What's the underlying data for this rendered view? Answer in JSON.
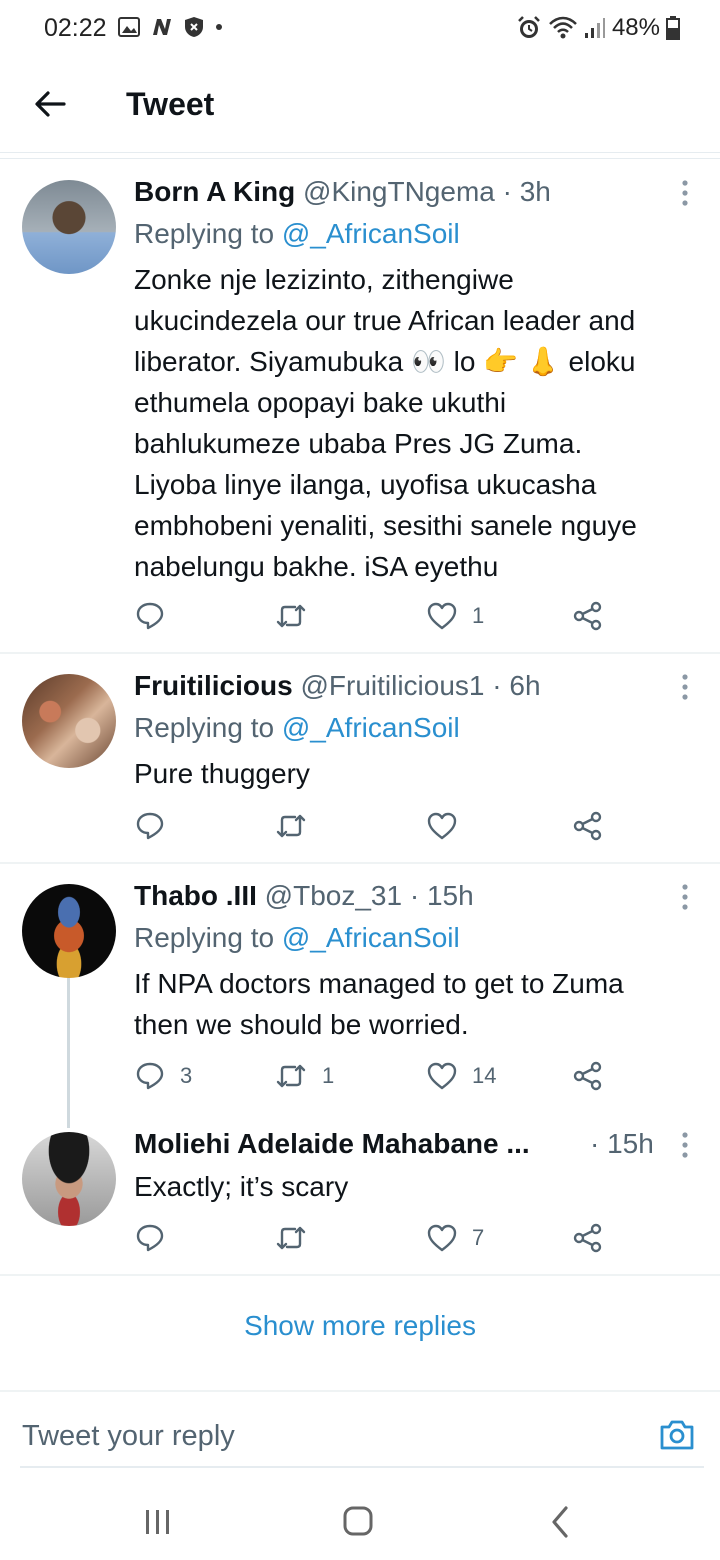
{
  "status_bar": {
    "time": "02:22",
    "battery": "48%"
  },
  "header": {
    "title": "Tweet"
  },
  "tweets": [
    {
      "name": "Born A King",
      "handle": "@KingTNgema · 3h",
      "replying_prefix": "Replying to ",
      "replying_to": "@_AfricanSoil",
      "lines": [
        "Zonke nje lezizinto, zithengiwe",
        "ukucindezela our true African leader and",
        "liberator. Siyamubuka 👀 lo 👉 👃 eloku",
        "ethumela opopayi bake ukuthi",
        "bahlukumeze ubaba Pres JG Zuma.",
        "Liyoba linye ilanga, uyofisa ukucasha",
        "embhobeni yenaliti, sesithi sanele nguye",
        "nabelungu bakhe. iSA eyethu"
      ],
      "replies": "",
      "retweets": "",
      "likes": "1"
    },
    {
      "name": "Fruitilicious",
      "handle": "@Fruitilicious1 · 6h",
      "replying_prefix": "Replying to ",
      "replying_to": "@_AfricanSoil",
      "lines": [
        "Pure thuggery"
      ],
      "replies": "",
      "retweets": "",
      "likes": ""
    },
    {
      "name": "Thabo .III",
      "handle": "@Tboz_31 · 15h",
      "replying_prefix": "Replying to ",
      "replying_to": "@_AfricanSoil",
      "lines": [
        "If NPA doctors managed to get to Zuma",
        "then we should be worried."
      ],
      "replies": "3",
      "retweets": "1",
      "likes": "14"
    },
    {
      "name": "Moliehi Adelaide Mahabane ...",
      "handle": "· 15h",
      "lines": [
        "Exactly; it’s scary"
      ],
      "replies": "",
      "retweets": "",
      "likes": "7"
    }
  ],
  "show_more": "Show more replies",
  "reply_box": {
    "placeholder": "Tweet your reply"
  },
  "colors": {
    "accent": "#2a8fcf",
    "muted": "#536471",
    "text": "#0f1419"
  }
}
